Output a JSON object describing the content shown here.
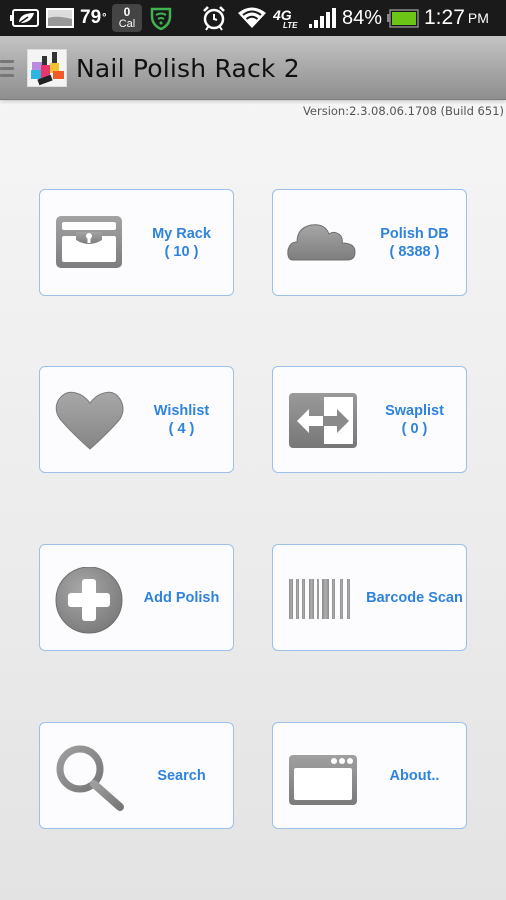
{
  "status_bar": {
    "temperature": "79",
    "temperature_unit": "°",
    "calories_value": "0",
    "calories_label": "Cal",
    "network_label": "4G LTE",
    "battery_percent": "84%",
    "time": "1:27",
    "time_period": "PM",
    "colors": {
      "security_icon": "#3fb34f",
      "battery_fill": "#6cc417"
    }
  },
  "action_bar": {
    "title": "Nail Polish Rack 2"
  },
  "version_text": "Version:2.3.08.06.1708 (Build 651)",
  "colors": {
    "tile_label": "#2f83dc",
    "tile_border": "#9cc0ea",
    "icon_gray": "#8c8c8c"
  },
  "tiles": [
    {
      "id": "my-rack",
      "label": "My Rack",
      "count": "( 10 )",
      "icon": "treasure-chest-icon"
    },
    {
      "id": "polish-db",
      "label": "Polish DB",
      "count": "( 8388 )",
      "icon": "cloud-icon"
    },
    {
      "id": "wishlist",
      "label": "Wishlist",
      "count": "( 4 )",
      "icon": "heart-icon"
    },
    {
      "id": "swaplist",
      "label": "Swaplist",
      "count": "( 0 )",
      "icon": "swap-arrows-icon"
    },
    {
      "id": "add-polish",
      "label": "Add Polish",
      "count": null,
      "icon": "plus-circle-icon"
    },
    {
      "id": "barcode-scan",
      "label": "Barcode Scan",
      "count": null,
      "icon": "barcode-icon"
    },
    {
      "id": "search",
      "label": "Search",
      "count": null,
      "icon": "magnifier-icon"
    },
    {
      "id": "about",
      "label": "About..",
      "count": null,
      "icon": "window-icon"
    }
  ]
}
